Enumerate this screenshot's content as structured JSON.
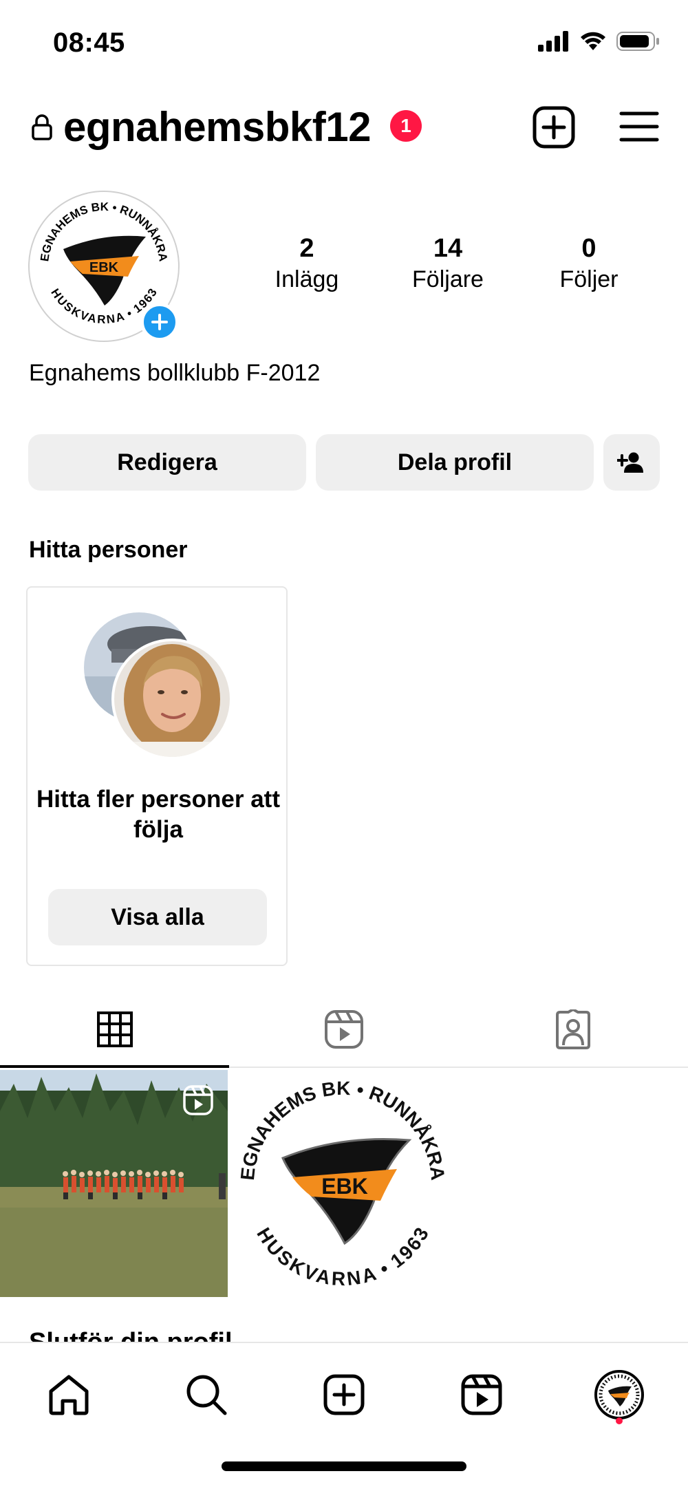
{
  "status_bar": {
    "time": "08:45"
  },
  "header": {
    "username": "egnahemsbkf12",
    "notification_count": "1"
  },
  "profile": {
    "logo_text_top": "EGNAHEMS BK • RUNNÅKRA",
    "logo_text_bottom": "HUSKVARNA • 1963",
    "logo_initials": "EBK",
    "stats": [
      {
        "value": "2",
        "label": "Inlägg"
      },
      {
        "value": "14",
        "label": "Följare"
      },
      {
        "value": "0",
        "label": "Följer"
      }
    ],
    "bio": "Egnahems bollklubb F-2012"
  },
  "actions": {
    "edit_label": "Redigera",
    "share_label": "Dela profil"
  },
  "discover": {
    "title": "Hitta personer",
    "card_text": "Hitta fler personer att följa",
    "button_label": "Visa alla"
  },
  "colors": {
    "badge": "#ff1744",
    "add_avatar": "#1d9bf0",
    "button_bg": "#efefef",
    "logo_orange": "#f28c1c"
  },
  "completion": {
    "title": "Slutför din profil"
  },
  "nav": {
    "icons": [
      "home-icon",
      "search-icon",
      "create-icon",
      "reels-icon",
      "profile-avatar"
    ]
  }
}
